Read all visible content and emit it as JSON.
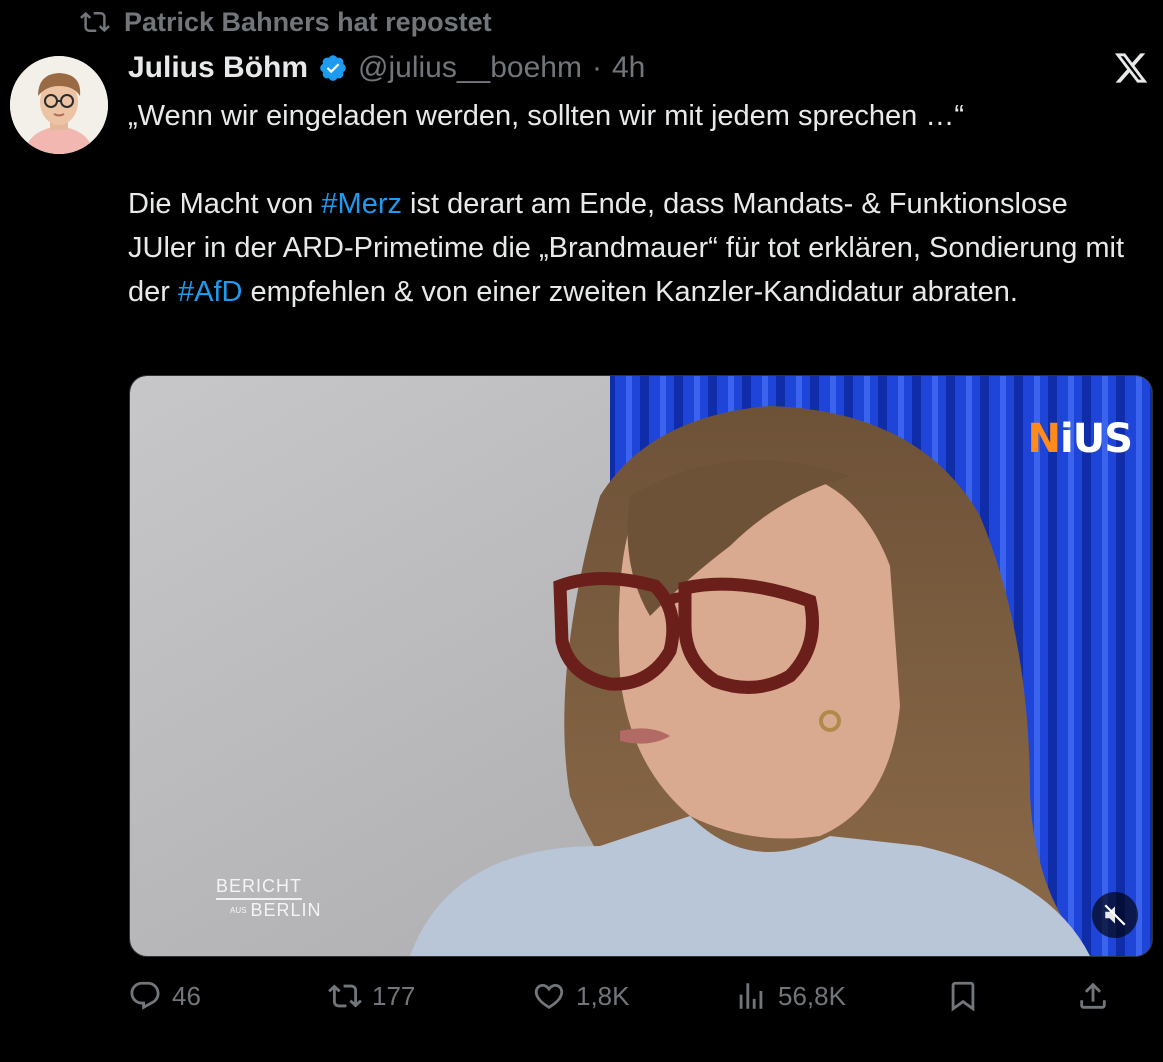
{
  "repost": {
    "icon": "repost-icon",
    "text": "Patrick Bahners hat repostet"
  },
  "author": {
    "name": "Julius Böhm",
    "verified": true,
    "handle": "@julius__boehm",
    "separator": "·",
    "time": "4h"
  },
  "tweet": {
    "quote_line": "„Wenn wir eingeladen werden, sollten wir mit jedem sprechen …“",
    "part1": "Die Macht von ",
    "hashtag1": "#Merz",
    "part2": " ist derart am Ende, dass Mandats- & Funktionslose JUler in der ARD-Primetime die „Brandmauer“ für tot erklären, Sondierung mit der ",
    "hashtag2": "#AfD",
    "part3": " empfehlen & von einer zweiten Kanzler-Kandidatur abraten."
  },
  "media": {
    "watermark_n": "N",
    "watermark_rest": "iUS",
    "show_logo_line1": "BERICHT",
    "show_logo_aus": "AUS",
    "show_logo_line2": "BERLIN",
    "mute_icon": "muted-speaker-icon"
  },
  "actions": {
    "replies": "46",
    "reposts": "177",
    "likes": "1,8K",
    "views": "56,8K"
  },
  "colors": {
    "background": "#000000",
    "text": "#e7e9ea",
    "muted": "#71767b",
    "accent": "#1d9bf0"
  }
}
